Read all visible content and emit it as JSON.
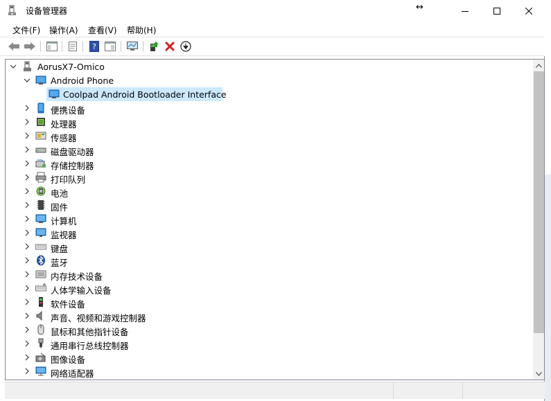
{
  "window": {
    "title": "设备管理器",
    "buttons": {
      "minimize": "minimize",
      "maximize": "maximize",
      "close": "close"
    }
  },
  "menu": {
    "items": [
      {
        "label": "文件(F)"
      },
      {
        "label": "操作(A)"
      },
      {
        "label": "查看(V)"
      },
      {
        "label": "帮助(H)"
      }
    ]
  },
  "toolbar": {
    "icons": [
      "back-arrow-icon",
      "forward-arrow-icon",
      "show-hide-console-tree-icon",
      "properties-icon",
      "help-icon",
      "action-pane-icon",
      "scan-hardware-icon",
      "update-driver-icon",
      "uninstall-device-icon",
      "disable-device-icon"
    ]
  },
  "tree": {
    "root": {
      "label": "AorusX7-Omico",
      "expanded": true
    },
    "android_phone": {
      "label": "Android Phone",
      "expanded": true
    },
    "selected_device": {
      "label": "Coolpad Android Bootloader Interface",
      "selected": true
    },
    "categories": [
      {
        "label": "便携设备",
        "icon": "portable-device-icon"
      },
      {
        "label": "处理器",
        "icon": "processor-icon"
      },
      {
        "label": "传感器",
        "icon": "sensor-icon"
      },
      {
        "label": "磁盘驱动器",
        "icon": "disk-drive-icon"
      },
      {
        "label": "存储控制器",
        "icon": "storage-controller-icon"
      },
      {
        "label": "打印队列",
        "icon": "printer-icon"
      },
      {
        "label": "电池",
        "icon": "battery-icon"
      },
      {
        "label": "固件",
        "icon": "firmware-icon"
      },
      {
        "label": "计算机",
        "icon": "computer-icon"
      },
      {
        "label": "监视器",
        "icon": "monitor-icon"
      },
      {
        "label": "键盘",
        "icon": "keyboard-icon"
      },
      {
        "label": "蓝牙",
        "icon": "bluetooth-icon"
      },
      {
        "label": "内存技术设备",
        "icon": "memory-device-icon"
      },
      {
        "label": "人体学输入设备",
        "icon": "hid-icon"
      },
      {
        "label": "软件设备",
        "icon": "software-device-icon"
      },
      {
        "label": "声音、视频和游戏控制器",
        "icon": "sound-icon"
      },
      {
        "label": "鼠标和其他指针设备",
        "icon": "mouse-icon"
      },
      {
        "label": "通用串行总线控制器",
        "icon": "usb-icon"
      },
      {
        "label": "图像设备",
        "icon": "imaging-device-icon"
      },
      {
        "label": "网络适配器",
        "icon": "network-adapter-icon"
      }
    ]
  },
  "colors": {
    "selection": "#cce8ff",
    "scroll_thumb": "#c2c2c2",
    "uninstall_red": "#d41e1e"
  }
}
